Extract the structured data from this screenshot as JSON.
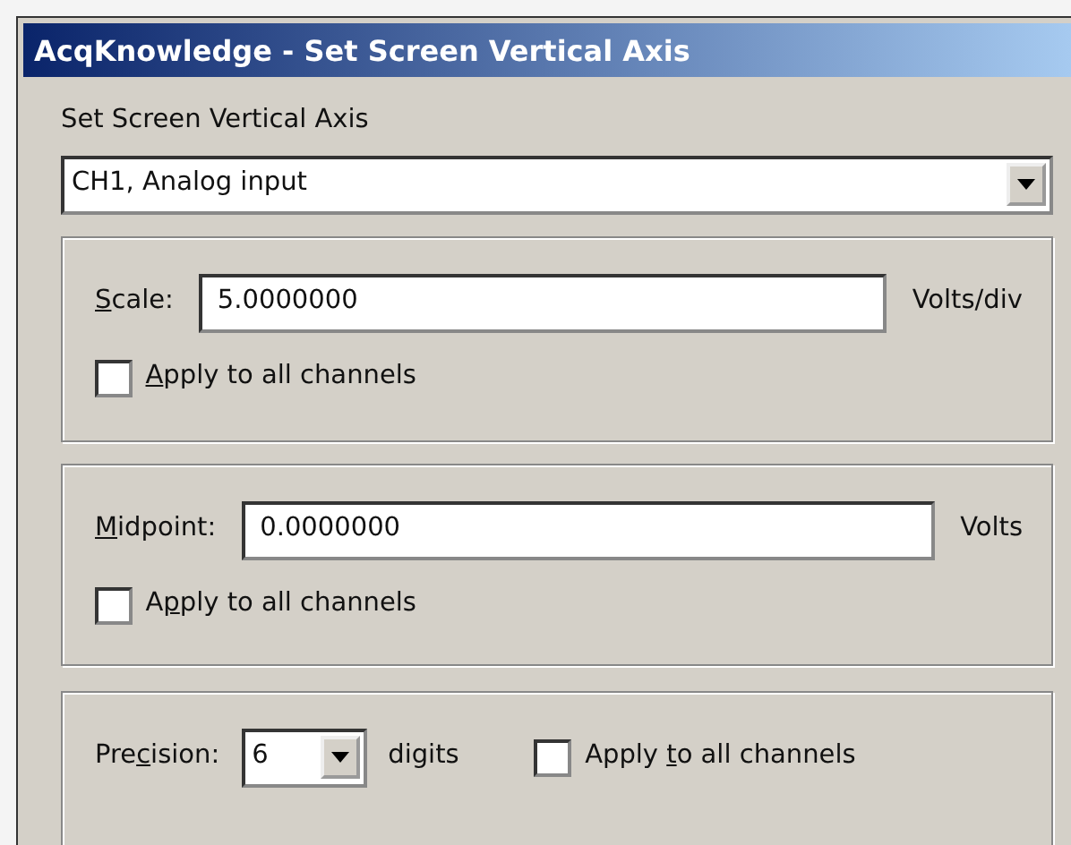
{
  "window": {
    "title": "AcqKnowledge - Set Screen Vertical Axis"
  },
  "channel_label": "Set Screen Vertical Axis",
  "channel_select": {
    "value": "CH1, Analog input"
  },
  "groups": [
    {
      "kind": "field",
      "label": {
        "key": "S",
        "post": "cale:"
      },
      "value": "5.0000000",
      "unit": "Volts/div",
      "apply": {
        "key": "A",
        "post": "pply to all channels",
        "checked": false
      }
    },
    {
      "kind": "field",
      "label": {
        "key": "M",
        "post": "idpoint:"
      },
      "value": "0.0000000",
      "unit": "Volts",
      "apply": {
        "pre": "A",
        "key": "p",
        "post": "ply to all channels",
        "checked": false
      }
    },
    {
      "kind": "precision",
      "label": {
        "pre": "Pre",
        "key": "c",
        "post": "ision:"
      },
      "value": "6",
      "unit": "digits",
      "apply": {
        "pre": "Apply ",
        "key": "t",
        "post": "o all channels",
        "checked": false
      }
    }
  ]
}
